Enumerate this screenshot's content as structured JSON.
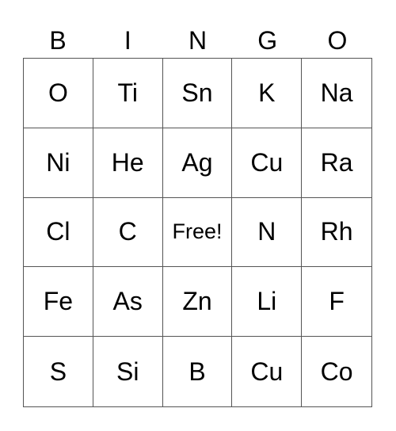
{
  "header": [
    "B",
    "I",
    "N",
    "G",
    "O"
  ],
  "grid": [
    [
      "O",
      "Ti",
      "Sn",
      "K",
      "Na"
    ],
    [
      "Ni",
      "He",
      "Ag",
      "Cu",
      "Ra"
    ],
    [
      "Cl",
      "C",
      "Free!",
      "N",
      "Rh"
    ],
    [
      "Fe",
      "As",
      "Zn",
      "Li",
      "F"
    ],
    [
      "S",
      "Si",
      "B",
      "Cu",
      "Co"
    ]
  ]
}
